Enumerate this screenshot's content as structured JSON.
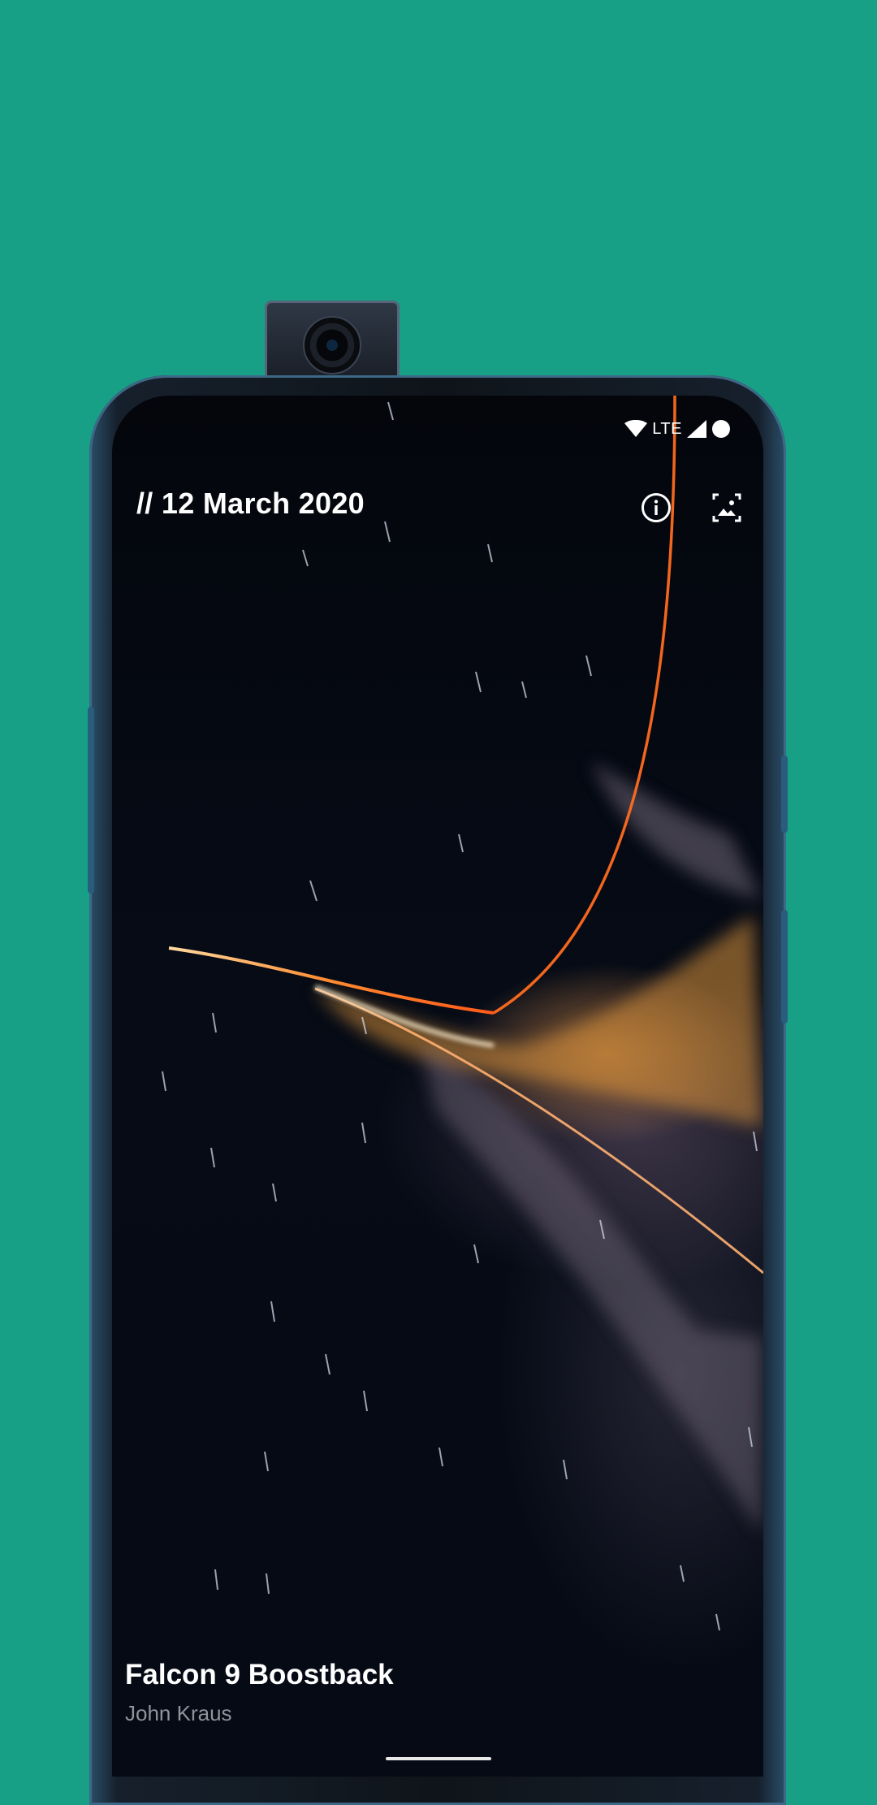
{
  "status_bar": {
    "network": "LTE",
    "icons": [
      "wifi-icon",
      "signal-icon",
      "battery-icon"
    ]
  },
  "app_bar": {
    "date_title": "// 12 March 2020",
    "actions": [
      {
        "name": "info-icon",
        "label": "Info"
      },
      {
        "name": "set-wallpaper-icon",
        "label": "Set wallpaper"
      }
    ]
  },
  "wallpaper": {
    "title": "Falcon 9 Boostback",
    "author": "John Kraus"
  },
  "colors": {
    "background": "#17a085",
    "trail_orange": "#ff7a2a",
    "glow_amber": "#f0a040",
    "text_primary": "#ffffff",
    "text_secondary": "#8f939b"
  }
}
